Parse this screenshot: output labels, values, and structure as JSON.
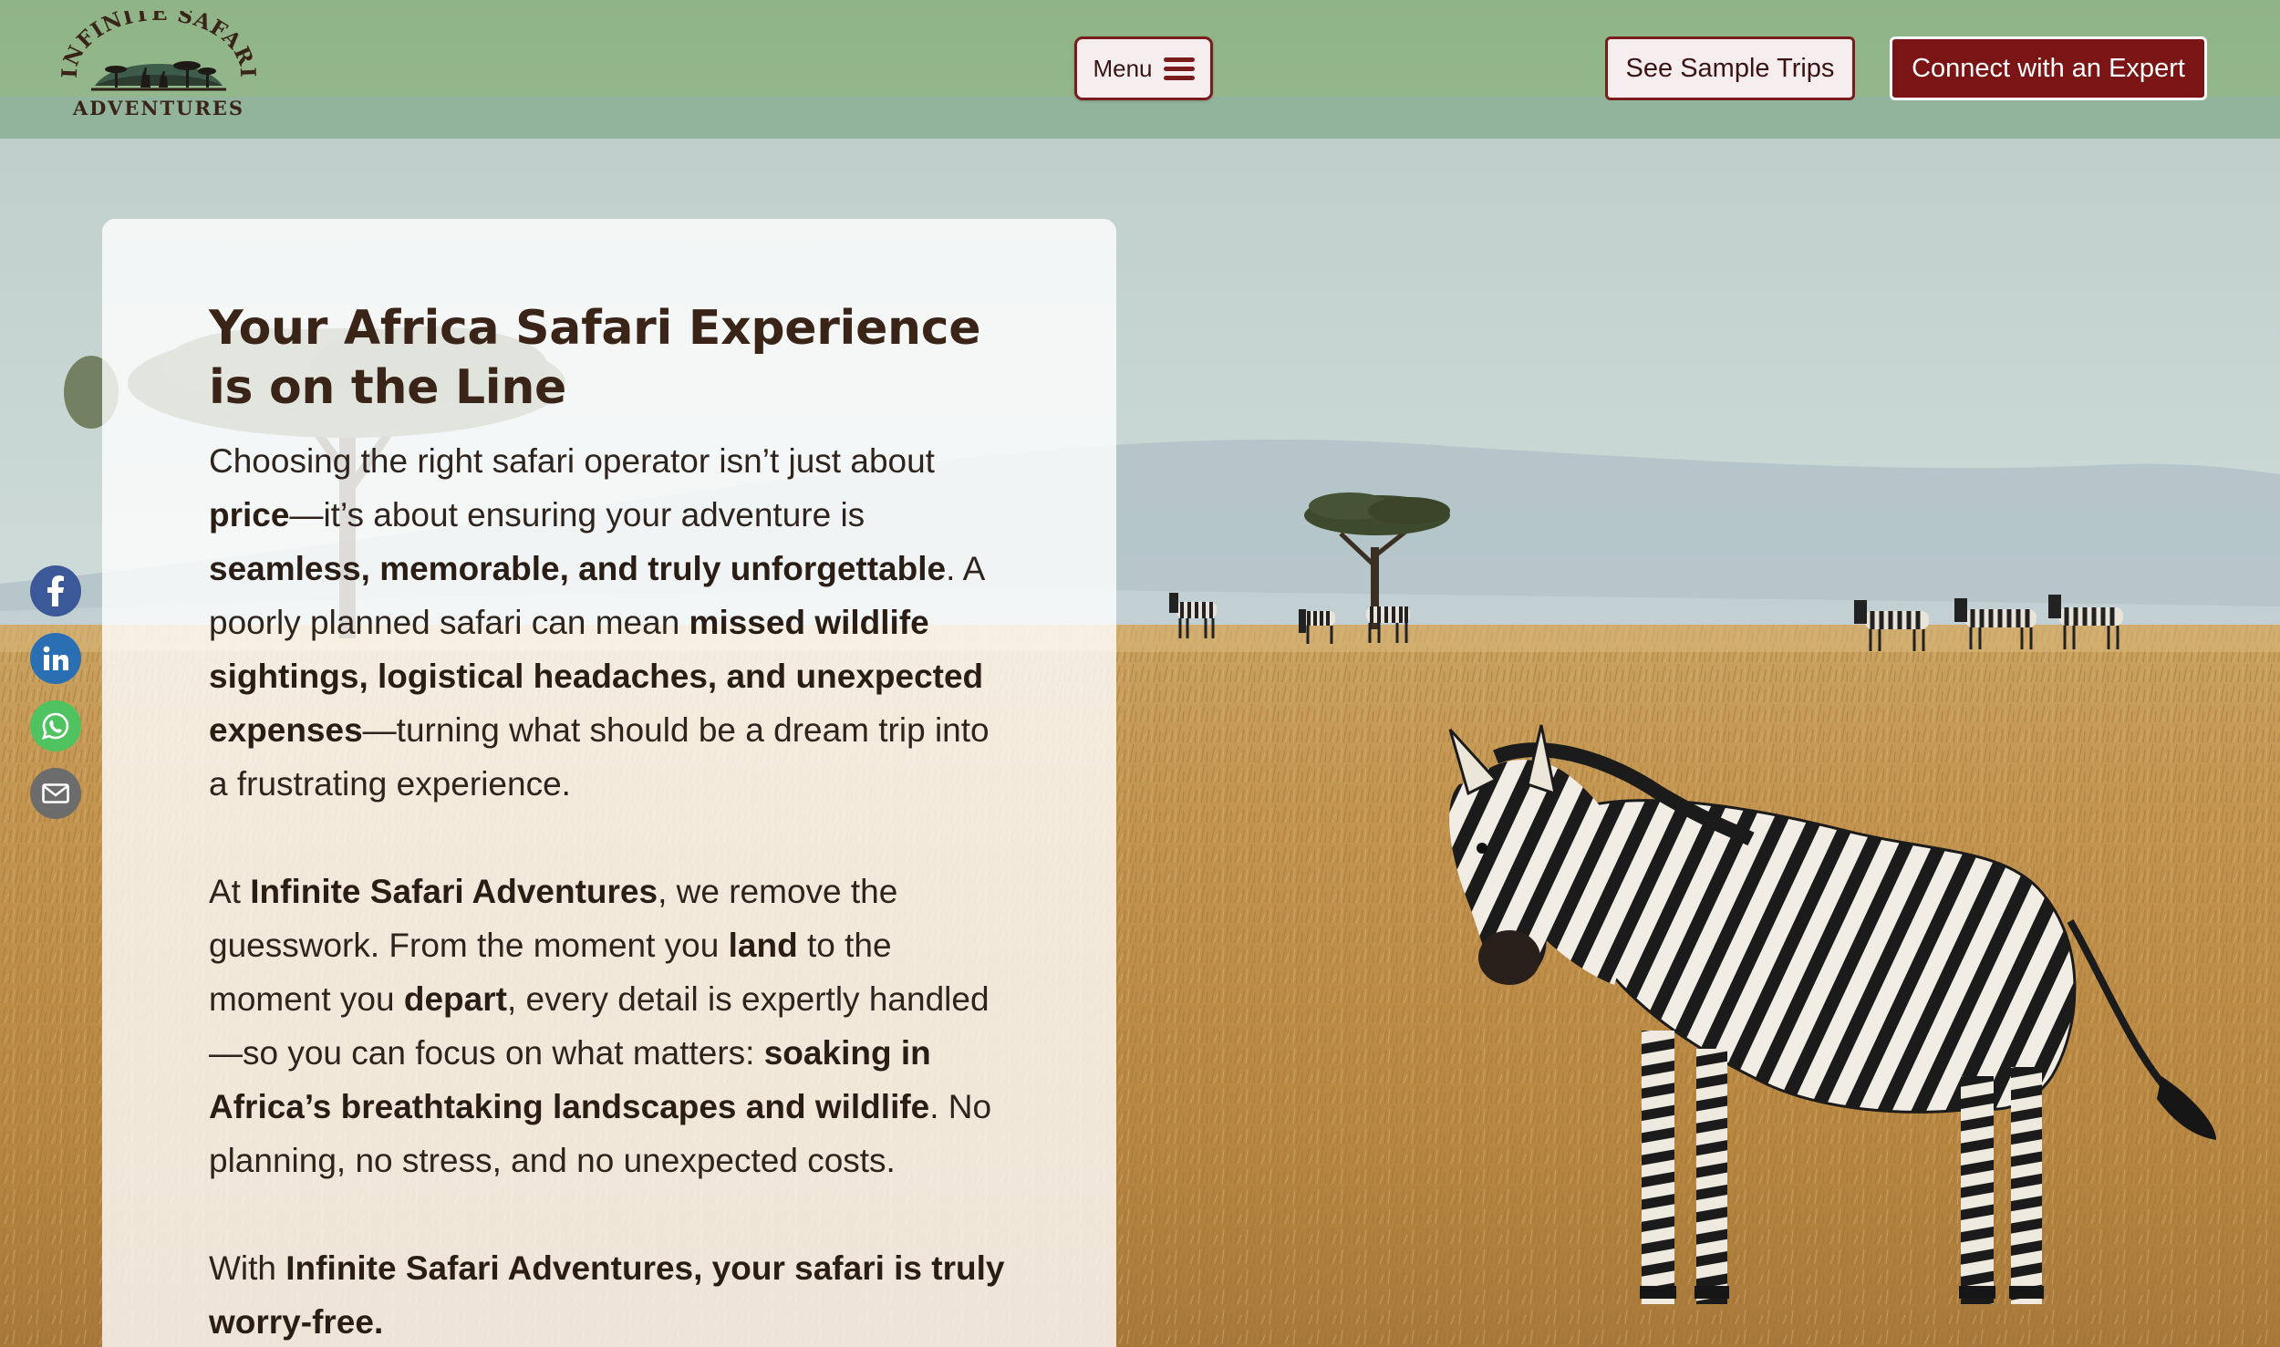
{
  "header": {
    "logo_top": "INFINITE SAFARI",
    "logo_bottom": "ADVENTURES",
    "menu_label": "Menu",
    "sample_trips_label": "See Sample Trips",
    "expert_label": "Connect with an Expert"
  },
  "colors": {
    "header_green": "#93b78b",
    "brand_maroon": "#7b1414",
    "text_brown": "#3a2418",
    "savanna_gold": "#c9a060"
  },
  "social": [
    {
      "name": "facebook",
      "icon": "facebook-icon"
    },
    {
      "name": "linkedin",
      "icon": "linkedin-icon"
    },
    {
      "name": "whatsapp",
      "icon": "whatsapp-icon"
    },
    {
      "name": "email",
      "icon": "email-icon"
    }
  ],
  "content": {
    "heading": "Your Africa Safari Experience is on the Line",
    "p1": [
      {
        "t": "Choosing the right safari operator isn’t just about "
      },
      {
        "t": "price",
        "b": true
      },
      {
        "t": "—it’s about ensuring your adventure is "
      },
      {
        "t": "seamless, memorable, and truly unforgettable",
        "b": true
      },
      {
        "t": ". A poorly planned safari can mean "
      },
      {
        "t": "missed wildlife sightings, logistical headaches, and unexpected expenses",
        "b": true
      },
      {
        "t": "—turning what should be a dream trip into a frustrating experience."
      }
    ],
    "p2": [
      {
        "t": "At "
      },
      {
        "t": "Infinite Safari Adventures",
        "b": true
      },
      {
        "t": ", we remove the guesswork. From the moment you "
      },
      {
        "t": "land",
        "b": true
      },
      {
        "t": " to the moment you "
      },
      {
        "t": "depart",
        "b": true
      },
      {
        "t": ", every detail is expertly handled—so you can focus on what matters: "
      },
      {
        "t": "soaking in Africa’s breathtaking landscapes and wildlife",
        "b": true
      },
      {
        "t": ". No planning, no stress, and no unexpected costs."
      }
    ],
    "p3": [
      {
        "t": "With "
      },
      {
        "t": "Infinite Safari Adventures, your safari is truly worry-free.",
        "b": true
      }
    ]
  }
}
